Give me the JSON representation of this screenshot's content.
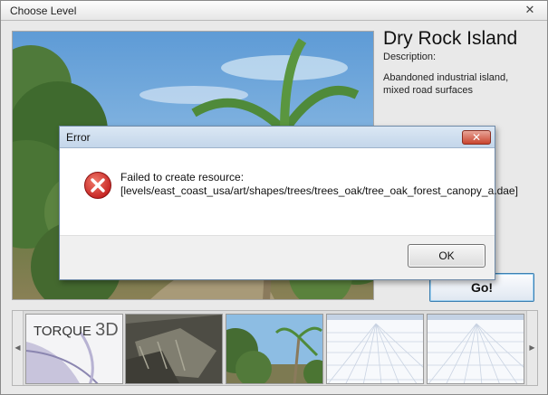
{
  "window": {
    "title": "Choose Level",
    "close_glyph": "✕"
  },
  "level": {
    "name": "Dry Rock Island",
    "description_label": "Description:",
    "description": "Abandoned industrial island, mixed road surfaces"
  },
  "go_button": {
    "label": "Go!"
  },
  "thumbnails": {
    "scroll_left_glyph": "◀",
    "scroll_right_glyph": "▶",
    "logo_text": "TORQUE",
    "logo_suffix": "3D"
  },
  "error_dialog": {
    "title": "Error",
    "close_glyph": "✕",
    "message": "Failed to create resource: [levels/east_coast_usa/art/shapes/trees/trees_oak/tree_oak_forest_canopy_a.dae]",
    "ok_label": "OK",
    "icon": "error-icon"
  },
  "colors": {
    "go_border": "#3c7fb1",
    "error_red": "#d42a2a",
    "dialog_title_bg": "#c4d6ea"
  }
}
